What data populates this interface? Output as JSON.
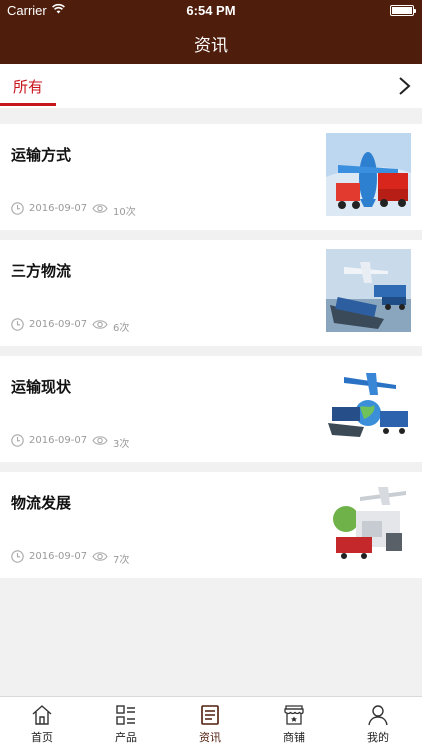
{
  "status_bar": {
    "carrier": "Carrier",
    "time": "6:54 PM"
  },
  "nav": {
    "title": "资讯"
  },
  "category_tabs": {
    "active": "所有"
  },
  "articles": [
    {
      "title": "运输方式",
      "date": "2016-09-07",
      "views": "10次",
      "thumb": "plane-truck-image"
    },
    {
      "title": "三方物流",
      "date": "2016-09-07",
      "views": "6次",
      "thumb": "ship-plane-image"
    },
    {
      "title": "运输现状",
      "date": "2016-09-07",
      "views": "3次",
      "thumb": "globe-logistics-image"
    },
    {
      "title": "物流发展",
      "date": "2016-09-07",
      "views": "7次",
      "thumb": "warehouse-logistics-image"
    }
  ],
  "tab_bar": [
    {
      "label": "首页",
      "icon": "home-icon"
    },
    {
      "label": "产品",
      "icon": "grid-list-icon"
    },
    {
      "label": "资讯",
      "icon": "news-icon",
      "active": true
    },
    {
      "label": "商铺",
      "icon": "shop-icon"
    },
    {
      "label": "我的",
      "icon": "user-icon"
    }
  ],
  "colors": {
    "nav_bg": "#4e1d0b",
    "accent": "#c8161d",
    "background": "#f1f1f1"
  }
}
